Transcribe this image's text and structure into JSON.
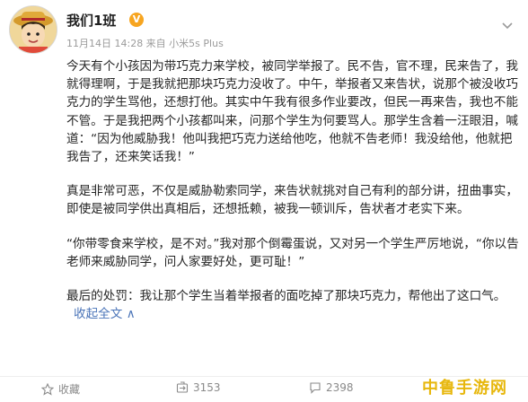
{
  "post": {
    "username": "我们1班",
    "meta": "11月14日 14:28 来自 小米5s Plus",
    "paragraphs": [
      "今天有个小孩因为带巧克力来学校，被同学举报了。民不告，官不理，民来告了，我就得理啊，于是我就把那块巧克力没收了。中午，举报者又来告状，说那个被没收巧克力的学生骂他，还想打他。其实中午我有很多作业要改，但民一再来告，我也不能不管。于是我把两个小孩都叫来，问那个学生为何要骂人。那学生含着一汪眼泪，喊道：“因为他威胁我！他叫我把巧克力送给他吃，他就不告老师！我没给他，他就把我告了，还来笑话我！”",
      "真是非常可恶，不仅是威胁勒索同学，来告状就挑对自己有利的部分讲，扭曲事实，即使是被同学供出真相后，还想抵赖，被我一顿训斥，告状者才老实下来。",
      "“你带零食来学校，是不对。”我对那个倒霉蛋说，又对另一个学生严厉地说，“你以告老师来威胁同学，问人家要好处，更可耻！”",
      "最后的处罚：我让那个学生当着举报者的面吃掉了那块巧克力，帮他出了这口气。"
    ],
    "collapse_label": "收起全文",
    "collapse_arrow": "∧"
  },
  "actions": {
    "collect": "收藏",
    "repost": "3153",
    "comment": "2398"
  },
  "watermark": "中鲁手游网"
}
